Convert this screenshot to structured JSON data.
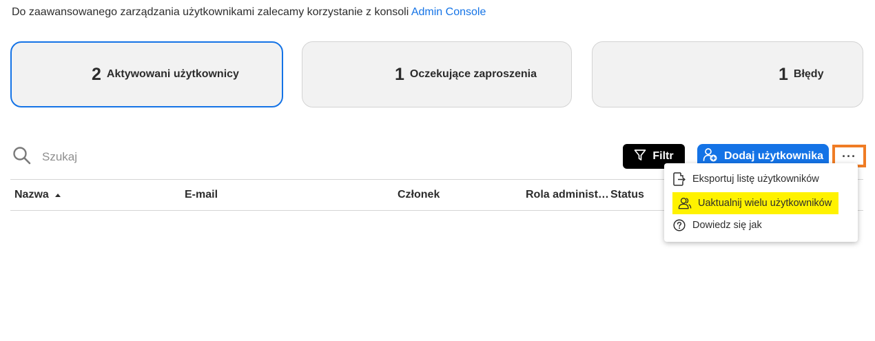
{
  "intro": {
    "text": "Do zaawansowanego zarządzania użytkownikami zalecamy korzystanie z konsoli",
    "link": "Admin Console",
    "link_color": "#1473e6"
  },
  "cards": [
    {
      "count": "2",
      "label": "Aktywowani użytkownicy",
      "active": true
    },
    {
      "count": "1",
      "label": "Oczekujące zaproszenia",
      "active": false
    },
    {
      "count": "1",
      "label": "Błędy",
      "active": false
    }
  ],
  "search": {
    "placeholder": "Szukaj",
    "icon": "search-icon"
  },
  "toolbar": {
    "filter_label": "Filtr",
    "add_user_label": "Dodaj użytkownika",
    "more_label": "···",
    "accent": "#1473e6",
    "highlight_border": "#f07c24"
  },
  "table": {
    "columns": [
      "Nazwa",
      "E-mail",
      "Członek",
      "Rola administ…",
      "Status"
    ],
    "sort_column": "Nazwa",
    "sort_direction": "ascending"
  },
  "menu": {
    "items": [
      {
        "label": "Eksportuj listę użytkowników",
        "icon": "export-icon"
      },
      {
        "label": "Uaktualnij wielu użytkowników",
        "icon": "users-icon",
        "highlighted": true,
        "highlight_color": "#fff200"
      },
      {
        "label": "Dowiedz się jak",
        "icon": "help-icon"
      }
    ]
  }
}
